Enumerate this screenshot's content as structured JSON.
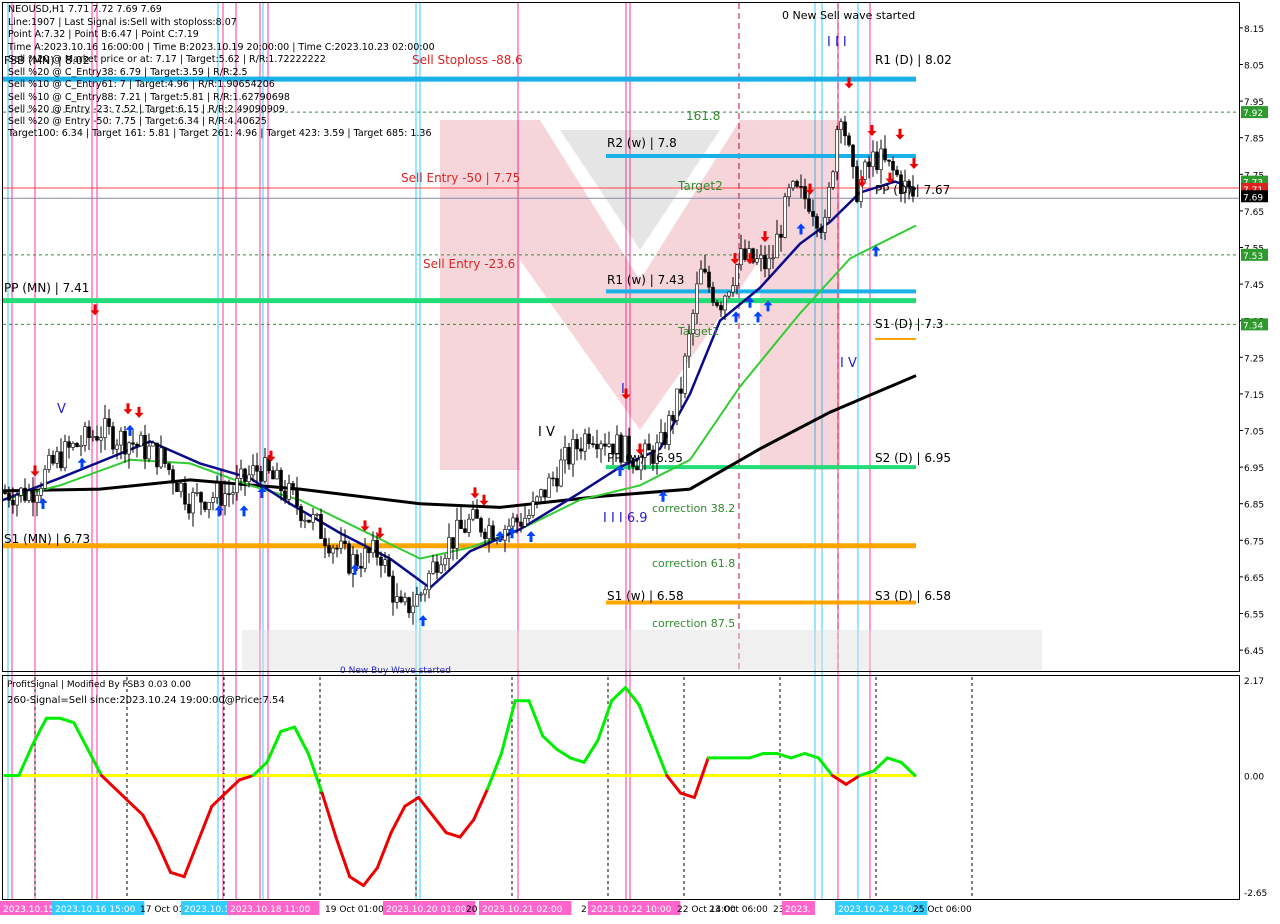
{
  "window": {
    "symbol_line": "NEOUSD,H1  7.71 7.72 7.69 7.69",
    "info_lines": [
      "Line:1907 | Last Signal is:Sell with stoploss:8.07",
      "Point A:7.32 | Point B:6.47 | Point C:7.19",
      "Time A:2023.10.16 16:00:00 | Time B:2023.10.19 20:00:00 | Time C:2023.10.23 02:00:00",
      "Sell %20 @ Market price or at: 7.17 | Target:5.62 | R/R:1.72222222",
      "Sell %20 @ C_Entry38: 6.79 | Target:3.59 | R/R:2.5",
      "Sell %10 @ C_Entry61: 7 | Target:4.96 | R/R:1.90654206",
      "Sell %10 @ C_Entry88: 7.21 | Target:5.81 | R/R:1.62790698",
      "Sell %20 @ Entry -23: 7.52 | Target:6.15 | R/R:2.49090909",
      "Sell %20 @ Entry -50: 7.75 | Target:6.34 | R/R:4.40625",
      "Target100: 6.34 | Target 161: 5.81 | Target 261: 4.96 | Target 423: 3.59 | Target 685: 1.36"
    ],
    "top_banner": "0 New Sell wave started"
  },
  "colors": {
    "background": "#ffffff",
    "level_blue": "#1ab0e8",
    "level_green": "#22dd77",
    "level_orange": "#ffa500",
    "ma_black": "#000000",
    "ma_blue": "#0a0a8a",
    "ma_green": "#33cc33",
    "signal_green": "#00ee00",
    "signal_red": "#ee0000",
    "signal_yellow": "#ffff00",
    "sell_arrow": "#ee0000",
    "buy_arrow": "#0044ff",
    "price_box_green": "#2e9a2e",
    "current_price_box": "#000000"
  },
  "chart_data": [
    {
      "type": "candlestick",
      "title": "NEOUSD,H1",
      "ylim": [
        6.41,
        8.18
      ],
      "yticks": [
        "8.15",
        "8.05",
        "7.95",
        "7.85",
        "7.75",
        "7.65",
        "7.55",
        "7.45",
        "7.35",
        "7.25",
        "7.15",
        "7.05",
        "6.95",
        "6.85",
        "6.75",
        "6.65",
        "6.55",
        "6.45"
      ],
      "grid": false,
      "price_tags": [
        {
          "label": "7.92",
          "value": 7.92,
          "color": "#2e9a2e"
        },
        {
          "label": "7.73",
          "value": 7.73,
          "color": "#2e9a2e"
        },
        {
          "label": "7.71",
          "value": 7.71,
          "color": "#dd2222"
        },
        {
          "label": "7.69",
          "value": 7.69,
          "color": "#000000"
        },
        {
          "label": "7.53",
          "value": 7.53,
          "color": "#2e9a2e"
        },
        {
          "label": "7.34",
          "value": 7.34,
          "color": "#2e9a2e"
        }
      ],
      "horizontal_levels": [
        {
          "label": "Sell Stoploss -88.6",
          "value": 8.01,
          "color": "#1ab0e8"
        },
        {
          "label": "FSB (MN) | 8.02",
          "value": 8.02,
          "color": "#1ab0e8"
        },
        {
          "label": "R1 (D) | 8.02",
          "value": 8.02,
          "color": "#1ab0e8"
        },
        {
          "label": "R2 (w) | 7.8",
          "value": 7.8,
          "color": "#1ab0e8"
        },
        {
          "label": "R1 (w) | 7.43",
          "value": 7.43,
          "color": "#1ab0e8"
        },
        {
          "label": "PP (MN) | 7.41",
          "value": 7.41,
          "color": "#22dd77"
        },
        {
          "label": "S1 (D) | 7.3",
          "value": 7.3,
          "color": "#ffa500"
        },
        {
          "label": "S2 (D) | 6.95",
          "value": 6.95,
          "color": "#22dd77"
        },
        {
          "label": "S1 (MN) | 6.73",
          "value": 6.73,
          "color": "#ffa500"
        },
        {
          "label": "S1 (w) | 6.58",
          "value": 6.58,
          "color": "#ffa500"
        },
        {
          "label": "S3 (D) | 6.58",
          "value": 6.58,
          "color": "#ffa500"
        }
      ],
      "dotted_levels": [
        7.92,
        7.53,
        7.34
      ],
      "red_line": 7.71,
      "annotations": [
        "161.8",
        "Target2",
        "Sell Entry -50 | 7.75",
        "Sell Entry -23.6",
        "PP (D) | 7.67",
        "Target1",
        "correction 38.2",
        "correction 61.8",
        "correction 87.5",
        "PP (w) | 6.95",
        "I I I 6.9",
        "I I I",
        "I V",
        "V",
        "I",
        "I V",
        "0 New Buy Wave started"
      ]
    },
    {
      "type": "line",
      "title": "ProfitSignal | Modified By FSB3 0.03 0.00",
      "subtitle": "260-Signal=Sell since:2023.10.24 19:00:00@Price:7.54",
      "yticks": [
        "2.17",
        "0.00",
        "-2.65"
      ],
      "ylim": [
        -2.65,
        2.17
      ],
      "series": [
        {
          "values": [
            0.0,
            0.0,
            0.7,
            1.3,
            1.3,
            1.2,
            0.6,
            0.0,
            -0.3,
            -0.6,
            -0.9,
            -1.5,
            -2.2,
            -2.3,
            -1.5,
            -0.7,
            -0.4,
            -0.1,
            0.0,
            0.3,
            1.0,
            1.1,
            0.5,
            -0.4,
            -1.4,
            -2.3,
            -2.5,
            -2.1,
            -1.3,
            -0.7,
            -0.5,
            -0.9,
            -1.3,
            -1.4,
            -1.0,
            -0.3,
            0.5,
            1.7,
            1.7,
            0.9,
            0.6,
            0.4,
            0.3,
            0.8,
            1.7,
            2.0,
            1.6,
            0.8,
            0.0,
            -0.4,
            -0.5,
            0.4,
            0.4,
            0.4,
            0.4,
            0.5,
            0.5,
            0.4,
            0.5,
            0.4,
            0.0,
            -0.2,
            0.0,
            0.1,
            0.4,
            0.3,
            0.0
          ]
        }
      ]
    }
  ],
  "time_axis": [
    {
      "label": "13 Oct 16:00",
      "highlight": false
    },
    {
      "label": "2023.10.15 18:00",
      "highlight": true
    },
    {
      "label": "2023.10.16 15:00",
      "highlight": true
    },
    {
      "label": "17 Oct 01:00",
      "highlight": false
    },
    {
      "label": "2023.10.17",
      "highlight": true
    },
    {
      "label": "2023.10.18 11:00",
      "highlight": true
    },
    {
      "label": "19 Oct 01:00",
      "highlight": false
    },
    {
      "label": "2023.10.20 01:00",
      "highlight": true
    },
    {
      "label": "20 Oct",
      "highlight": false
    },
    {
      "label": "2023.10.21 02:00",
      "highlight": true
    },
    {
      "label": "21 Oct",
      "highlight": false
    },
    {
      "label": "2023.10.22 10:00",
      "highlight": true
    },
    {
      "label": "22 Oct 14:00",
      "highlight": false
    },
    {
      "label": "23 Oct 06:00",
      "highlight": false
    },
    {
      "label": "23 Oct",
      "highlight": false
    },
    {
      "label": "2023.",
      "highlight": true
    },
    {
      "label": "2023.10.24 23:00",
      "highlight": true
    },
    {
      "label": "25 Oct 06:00",
      "highlight": false
    }
  ]
}
